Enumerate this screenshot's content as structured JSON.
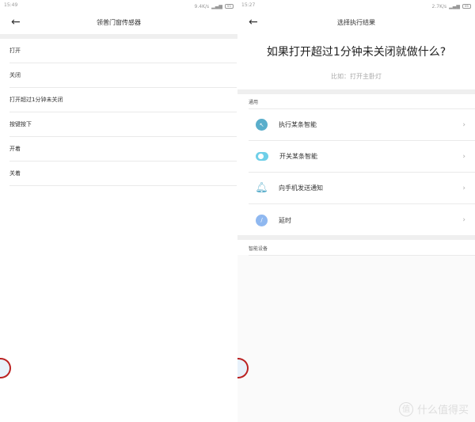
{
  "left": {
    "status": {
      "time": "15:49",
      "speed": "9.4K/s",
      "battery": "85"
    },
    "title": "领普门窗传感器",
    "items": [
      "打开",
      "关闭",
      "打开超过1分钟未关闭",
      "按键按下",
      "开着",
      "关着"
    ]
  },
  "right": {
    "status": {
      "time": "15:27",
      "speed": "2.7K/s",
      "battery": "86"
    },
    "title": "选择执行结果",
    "question": "如果打开超过1分钟未关闭就做什么?",
    "hint": "比如：打开主卧灯",
    "section_general": "通用",
    "items": [
      {
        "label": "执行某条智能",
        "icon": "cursor-icon",
        "color": "#5aaecb"
      },
      {
        "label": "开关某条智能",
        "icon": "toggle-icon",
        "color": "#6fcfe8"
      },
      {
        "label": "向手机发送通知",
        "icon": "bell-icon",
        "color": "#5aaecb"
      },
      {
        "label": "延时",
        "icon": "clock-icon",
        "color": "#8fb8f0"
      }
    ],
    "section_devices": "智能设备"
  },
  "watermark": {
    "badge": "值",
    "text": "什么值得买"
  }
}
